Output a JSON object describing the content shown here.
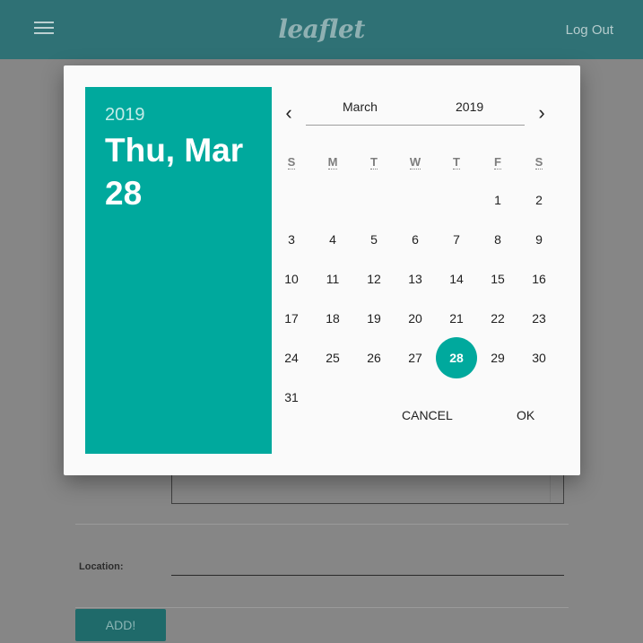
{
  "appbar": {
    "logo": "leaflet",
    "logout_label": "Log Out"
  },
  "form": {
    "location_label": "Location:",
    "add_button_label": "ADD!"
  },
  "dialog": {
    "header": {
      "year": "2019",
      "date": "Thu, Mar 28"
    },
    "selector": {
      "month": "March",
      "year": "2019",
      "prev_icon": "chevron-left-icon",
      "next_icon": "chevron-right-icon"
    },
    "weekdays": [
      "S",
      "M",
      "T",
      "W",
      "T",
      "F",
      "S"
    ],
    "first_weekday_index": 5,
    "days_in_month": 31,
    "selected_day": 28,
    "actions": {
      "cancel": "CANCEL",
      "ok": "OK"
    },
    "colors": {
      "accent": "#00a99d",
      "appbar": "#2f7175"
    }
  }
}
